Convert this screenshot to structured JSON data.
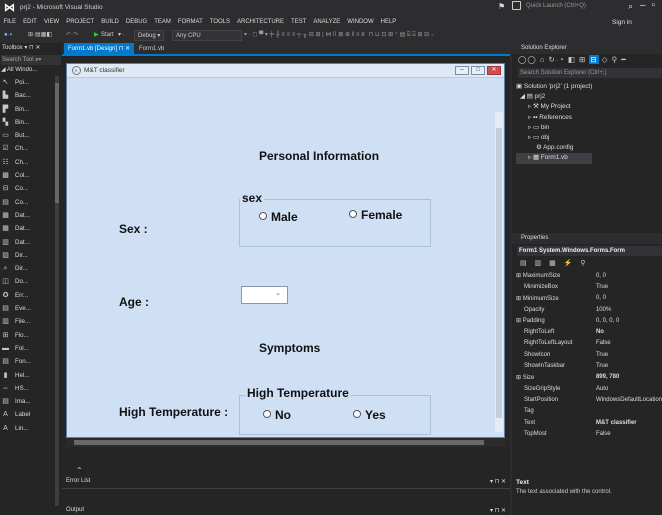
{
  "window": {
    "title": "prj2 - Microsoft Visual Studio",
    "quick_launch": "Quick Launch (Ctrl+Q)",
    "sign_in": "Sign in"
  },
  "menu": [
    "FILE",
    "EDIT",
    "VIEW",
    "PROJECT",
    "BUILD",
    "DEBUG",
    "TEAM",
    "FORMAT",
    "TOOLS",
    "ARCHITECTURE",
    "TEST",
    "ANALYZE",
    "WINDOW",
    "HELP"
  ],
  "toolbar": {
    "start": "Start",
    "config": "Debug",
    "platform": "Any CPU"
  },
  "toolbox": {
    "header": "Toolbox",
    "search": "Search Tool",
    "group": "All Windo...",
    "items": [
      {
        "icon": "pointer-icon",
        "label": "Poi..."
      },
      {
        "icon": "background-worker-icon",
        "label": "Bac..."
      },
      {
        "icon": "binding-navigator-icon",
        "label": "Bin..."
      },
      {
        "icon": "binding-source-icon",
        "label": "Bin..."
      },
      {
        "icon": "button-icon",
        "label": "But..."
      },
      {
        "icon": "checkbox-icon",
        "label": "Ch..."
      },
      {
        "icon": "checked-listbox-icon",
        "label": "Ch..."
      },
      {
        "icon": "color-dialog-icon",
        "label": "Col..."
      },
      {
        "icon": "combobox-icon",
        "label": "Co..."
      },
      {
        "icon": "context-menu-icon",
        "label": "Co..."
      },
      {
        "icon": "dataset-icon",
        "label": "Dat..."
      },
      {
        "icon": "datagridview-icon",
        "label": "Dat..."
      },
      {
        "icon": "datetimepicker-icon",
        "label": "Dat..."
      },
      {
        "icon": "directory-entry-icon",
        "label": "Dir..."
      },
      {
        "icon": "directory-searcher-icon",
        "label": "Dir..."
      },
      {
        "icon": "domain-updown-icon",
        "label": "Do..."
      },
      {
        "icon": "error-provider-icon",
        "label": "Err..."
      },
      {
        "icon": "eventlog-icon",
        "label": "Eve..."
      },
      {
        "icon": "filesystemwatcher-icon",
        "label": "File..."
      },
      {
        "icon": "flowlayoutpanel-icon",
        "label": "Flo..."
      },
      {
        "icon": "folder-browser-icon",
        "label": "Fol..."
      },
      {
        "icon": "font-dialog-icon",
        "label": "Fon..."
      },
      {
        "icon": "groupbox-icon",
        "label": "Hel..."
      },
      {
        "icon": "hscrollbar-icon",
        "label": "HS..."
      },
      {
        "icon": "imagelist-icon",
        "label": "Ima..."
      },
      {
        "icon": "label-icon",
        "label": "Label"
      },
      {
        "icon": "linklabel-icon",
        "label": "Lin..."
      }
    ]
  },
  "tabs": [
    {
      "label": "Form1.vb [Design]"
    },
    {
      "label": "Form1.vb"
    }
  ],
  "form": {
    "title": "M&T classifier",
    "heading_personal": "Personal Information",
    "sex_label": "Sex :",
    "sex_group": "sex",
    "male": "Male",
    "female": "Female",
    "age_label": "Age :",
    "heading_symptoms": "Symptoms",
    "temp_label": "High Temperature :",
    "temp_group": "High Temperature",
    "no": "No",
    "yes": "Yes"
  },
  "bottom": {
    "error_list": "Error List",
    "output": "Output"
  },
  "solution_explorer": {
    "header": "Solution Explorer",
    "search": "Search Solution Explorer (Ctrl+;)",
    "nodes": [
      "Solution 'prj2' (1 project)",
      "prj2",
      "My Project",
      "References",
      "bin",
      "obj",
      "App.config",
      "Form1.vb"
    ]
  },
  "properties": {
    "header": "Properties",
    "object": "Form1 System.Windows.Forms.Form",
    "rows": [
      [
        "⊞ MaximumSize",
        "0, 0"
      ],
      [
        "MinimizeBox",
        "True"
      ],
      [
        "⊞ MinimumSize",
        "0, 0"
      ],
      [
        "Opacity",
        "100%"
      ],
      [
        "⊞ Padding",
        "0, 0, 0, 0"
      ],
      [
        "RightToLeft",
        "No"
      ],
      [
        "RightToLeftLayout",
        "False"
      ],
      [
        "ShowIcon",
        "True"
      ],
      [
        "ShowInTaskbar",
        "True"
      ],
      [
        "⊞ Size",
        "899, 780"
      ],
      [
        "SizeGripStyle",
        "Auto"
      ],
      [
        "StartPosition",
        "WindowsDefaultLocation"
      ],
      [
        "Tag",
        ""
      ],
      [
        "Text",
        "M&T classifier"
      ],
      [
        "TopMost",
        "False"
      ]
    ],
    "desc_title": "Text",
    "desc_text": "The text associated with the control."
  }
}
